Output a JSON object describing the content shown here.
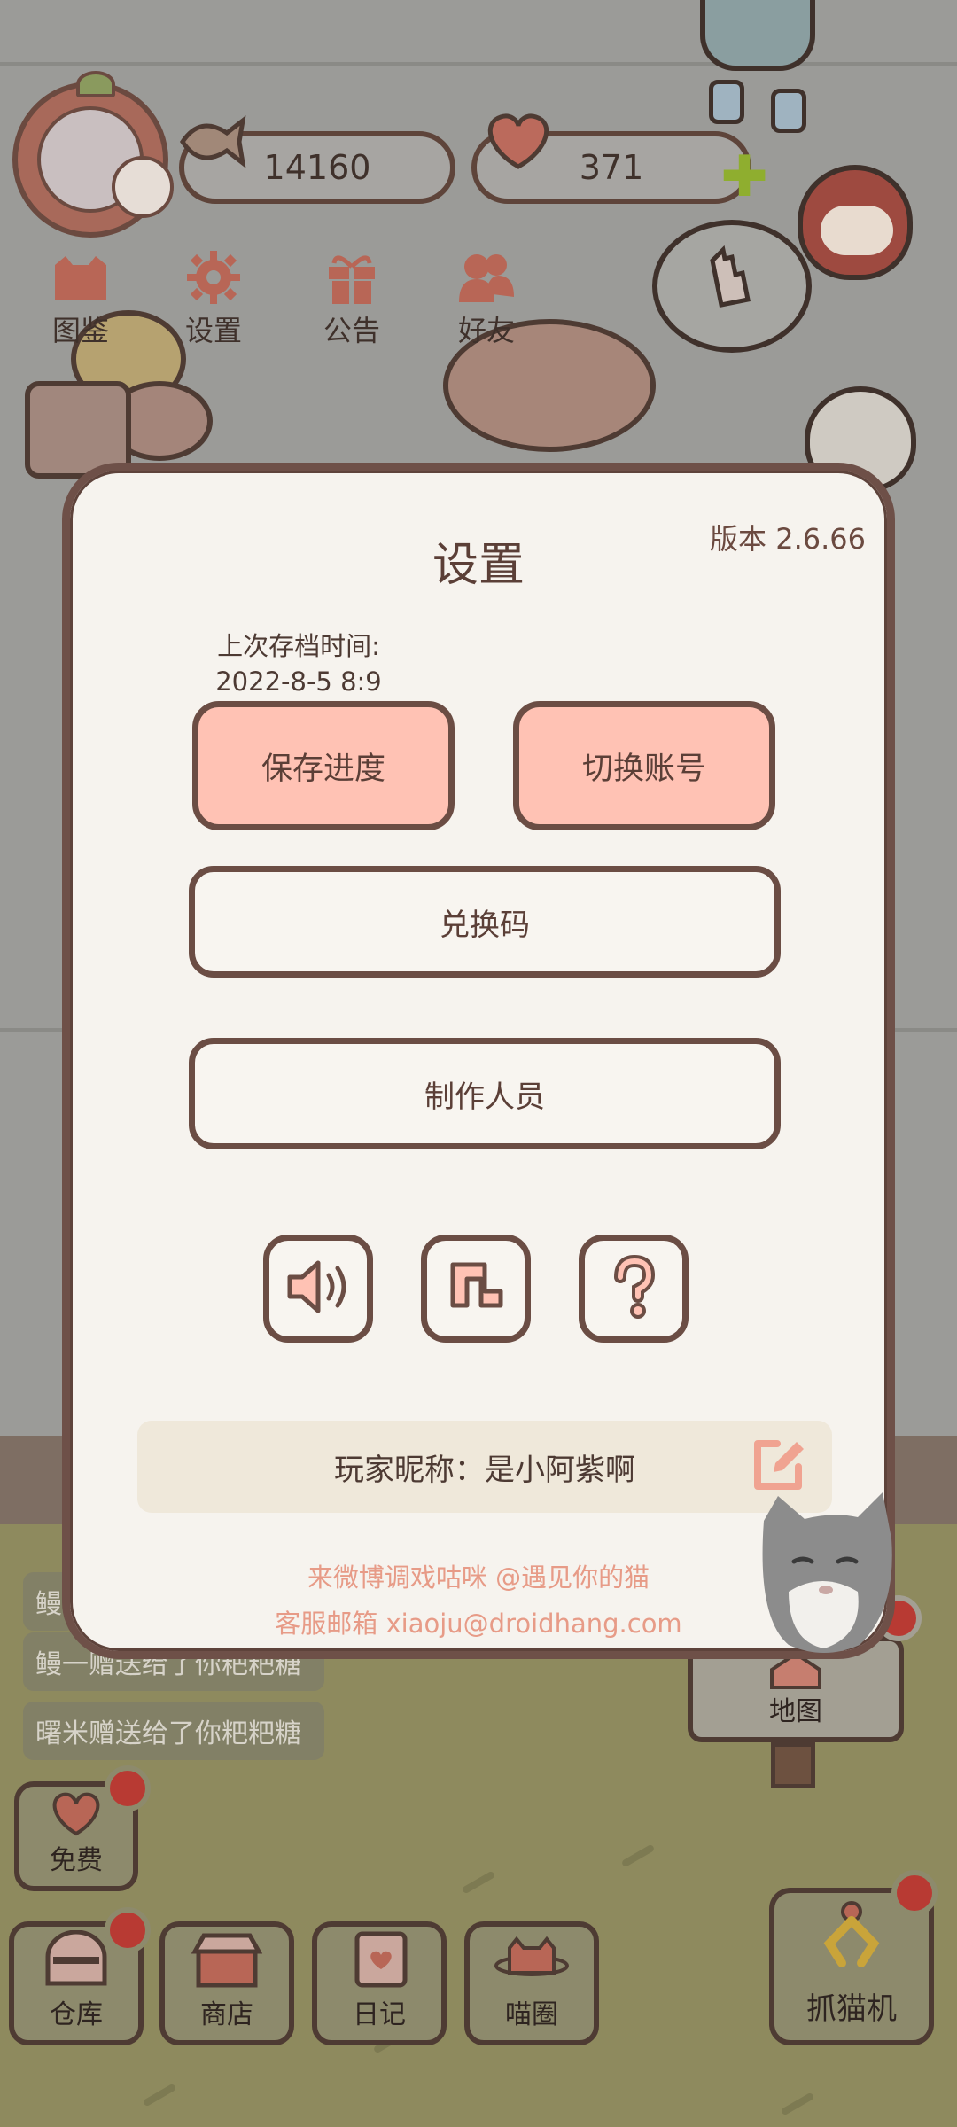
{
  "hud": {
    "fish_count": "14160",
    "heart_count": "371"
  },
  "top_nav": [
    {
      "label": "图鉴",
      "icon": "cat-book-icon"
    },
    {
      "label": "设置",
      "icon": "gear-icon"
    },
    {
      "label": "公告",
      "icon": "gift-icon"
    },
    {
      "label": "好友",
      "icon": "friends-icon"
    }
  ],
  "chat": [
    {
      "text": "鳗"
    },
    {
      "text": "鳗一赠送给了你粑粑糖"
    },
    {
      "text": "曙米赠送给了你粑粑糖"
    }
  ],
  "bottom_nav": {
    "free": "免费",
    "storage": "仓库",
    "shop": "商店",
    "diary": "日记",
    "meow_circle": "喵圈",
    "map": "地图",
    "claw_machine": "抓猫机"
  },
  "settings": {
    "title": "设置",
    "version": "版本 2.6.66",
    "last_save_label": "上次存档时间:",
    "last_save_time": "2022-8-5 8:9",
    "save_progress": "保存进度",
    "switch_account": "切换账号",
    "redeem_code": "兑换码",
    "credits": "制作人员",
    "icons": [
      "sound-icon",
      "music-icon",
      "help-icon"
    ],
    "nickname": "玩家昵称：是小阿紫啊",
    "weibo_text": "来微博调戏咕咪 @遇见你的猫",
    "support_email": "客服邮箱 xiaoju@droidhang.com"
  },
  "colors": {
    "pink_button": "#ffc2b4",
    "dialog_bg": "#f6f3ee",
    "border_brown": "#6b4d44",
    "link_text": "#e79b87",
    "notify_red": "#b83a33"
  }
}
